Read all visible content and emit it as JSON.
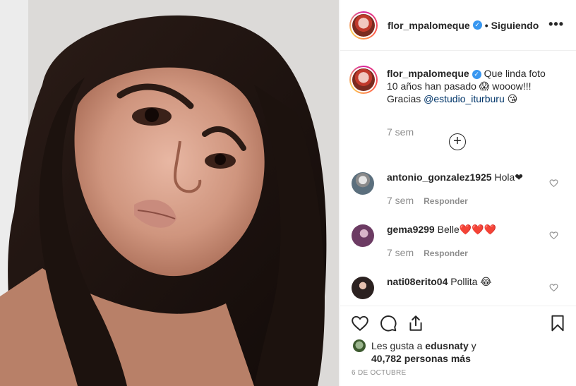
{
  "post": {
    "username": "flor_mpalomeque",
    "separator": "•",
    "follow_status": "Siguiendo",
    "more_label": "•••"
  },
  "caption": {
    "username": "flor_mpalomeque",
    "text_part1": " Que linda foto 10 años han pasado ",
    "emoji_scream": "😱",
    "text_part2": " wooow!!! Gracias ",
    "mention": "@estudio_iturburu",
    "emoji_kiss": " 😘",
    "time": "7 sem"
  },
  "load_more_label": "+",
  "comments": [
    {
      "username": "antonio_gonzalez1925",
      "text": " Hola❤",
      "time": "7 sem",
      "reply_label": "Responder"
    },
    {
      "username": "gema9299",
      "text": " Belle❤️❤️❤️",
      "time": "7 sem",
      "reply_label": "Responder"
    },
    {
      "username": "nati08erito04",
      "text": " Pollita 😂",
      "time": "",
      "reply_label": ""
    }
  ],
  "likes": {
    "prefix": "Les gusta a ",
    "user": "edusnaty",
    "middle": " y ",
    "count": "40,782 personas más"
  },
  "date": "6 DE OCTUBRE",
  "colors": {
    "link": "#003569",
    "muted": "#8e8e8e",
    "verified": "#3897f0",
    "border": "#efefef"
  }
}
